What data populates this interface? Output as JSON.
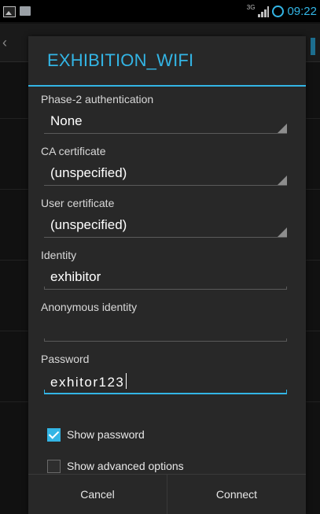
{
  "status_bar": {
    "network": "3G",
    "time": "09:22"
  },
  "dialog": {
    "title": "EXHIBITION_WIFI",
    "phase2": {
      "label": "Phase-2 authentication",
      "value": "None"
    },
    "ca_cert": {
      "label": "CA certificate",
      "value": "(unspecified)"
    },
    "user_cert": {
      "label": "User certificate",
      "value": "(unspecified)"
    },
    "identity": {
      "label": "Identity",
      "value": "exhibitor"
    },
    "anon_identity": {
      "label": "Anonymous identity",
      "value": ""
    },
    "password": {
      "label": "Password",
      "value": "exhitor123"
    },
    "show_password": {
      "label": "Show password",
      "checked": true
    },
    "advanced": {
      "label": "Show advanced options",
      "checked": false
    },
    "buttons": {
      "cancel": "Cancel",
      "connect": "Connect"
    }
  },
  "colors": {
    "accent": "#33b5e5",
    "dialog_bg": "#282828"
  }
}
